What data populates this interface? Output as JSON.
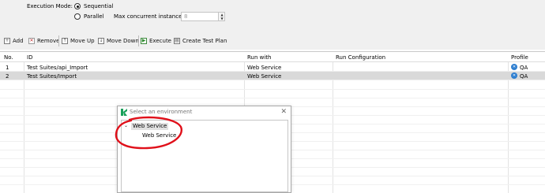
{
  "settings": {
    "execution_mode_label": "Execution Mode:",
    "sequential_label": "Sequential",
    "parallel_label": "Parallel",
    "selected_mode": "Sequential",
    "max_instances_label": "Max concurrent instances:",
    "max_instances_value": "8"
  },
  "toolbar": {
    "add": "Add",
    "remove": "Remove",
    "move_up": "Move Up",
    "move_down": "Move Down",
    "execute": "Execute",
    "create_test_plan": "Create Test Plan"
  },
  "table": {
    "columns": [
      "No.",
      "ID",
      "Run with",
      "Run Configuration",
      "Profile"
    ],
    "rows": [
      {
        "no": "1",
        "id": "Test Suites/api_Import",
        "run_with": "Web Service",
        "run_configuration": "",
        "profile": "QA"
      },
      {
        "no": "2",
        "id": "Test Suites/Import",
        "run_with": "Web Service",
        "run_configuration": "",
        "profile": "QA"
      }
    ],
    "selected_row": 2
  },
  "dialog": {
    "title": "Select an environment",
    "close_glyph": "✕",
    "tree": {
      "group": "Web Service",
      "child": "Web Service"
    }
  },
  "colors": {
    "annotation": "#e0101a",
    "selected_row": "#d9d9d9",
    "profile_icon": "#2f7fd0",
    "toolbar_bg": "#f0f0f0"
  }
}
